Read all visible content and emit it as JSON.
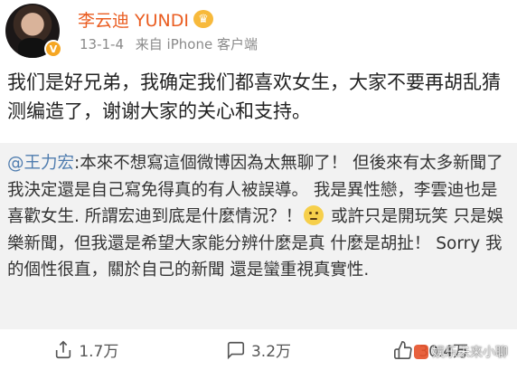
{
  "header": {
    "name": "李云迪 YUNDI",
    "crown_icon": "crown-icon",
    "verified_badge": "V",
    "date": "13-1-4",
    "source": "来自 iPhone 客户端",
    "brand_color": "#ea5d21"
  },
  "post": {
    "text": "我们是好兄弟，我确定我们都喜欢女生，大家不要再胡乱猜测编造了，谢谢大家的关心和支持。"
  },
  "repost": {
    "mention": "@王力宏",
    "text_before_emoji": ":本來不想寫這個微博因為太無聊了！ 但後來有太多新聞了 我決定還是自己寫免得真的有人被誤導。 我是異性戀，李雲迪也是喜歡女生. 所謂宏迪到底是什麼情況？！",
    "emoji": "thinking-emoji",
    "text_after_emoji": " 或許只是開玩笑 只是娛樂新聞，但我還是希望大家能分辨什麼是真 什麼是胡扯！ Sorry 我的個性很直，關於自己的新聞 還是蠻重視真實性."
  },
  "actions": {
    "repost_count": "1.7万",
    "comment_count": "3.2万",
    "like_count": "30.4万"
  },
  "watermark": {
    "text": "娱乐未来小聊"
  }
}
